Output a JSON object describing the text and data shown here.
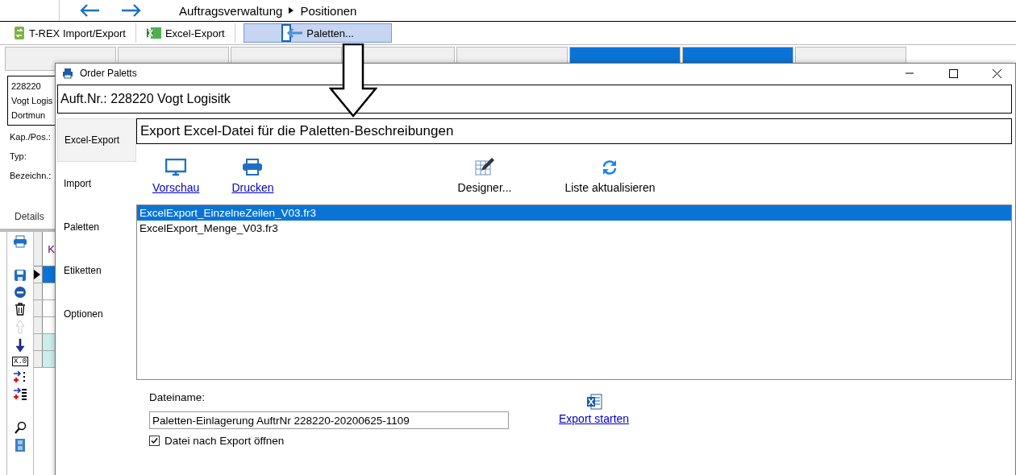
{
  "breadcrumb": [
    "Auftragsverwaltung",
    "Positionen"
  ],
  "toolbar": [
    {
      "kind": "sync",
      "label": "T-REX Import/Export",
      "selected": false
    },
    {
      "kind": "excel",
      "label": "Excel-Export",
      "selected": false
    },
    {
      "kind": "pallet",
      "label": "Paletten...",
      "selected": true
    }
  ],
  "view_tabs": [
    {
      "highlighted": false
    },
    {
      "highlighted": false
    },
    {
      "highlighted": false
    },
    {
      "highlighted": false
    },
    {
      "highlighted": false
    },
    {
      "highlighted": true
    },
    {
      "highlighted": true
    },
    {
      "highlighted": false
    }
  ],
  "order_box": [
    "228220",
    "Vogt Logis",
    "Dortmun"
  ],
  "fields": [
    "Kap./Pos.:",
    "Typ:",
    "Bezeichn.:"
  ],
  "details": "Details",
  "side_tools": [
    {
      "kind": "print"
    },
    {
      "kind": "save"
    },
    {
      "kind": "remove"
    },
    {
      "kind": "trash"
    },
    {
      "kind": "up",
      "disabled": true
    },
    {
      "kind": "down",
      "disabled": false
    },
    {
      "kind": "decimal",
      "label": "X.0"
    },
    {
      "kind": "insert"
    },
    {
      "kind": "insert-list"
    },
    {
      "kind": "search"
    },
    {
      "kind": "film"
    }
  ],
  "grid": {
    "column_1": "K",
    "rows": [
      {
        "selected": true,
        "tinted": false
      },
      {
        "selected": false,
        "tinted": false
      },
      {
        "selected": false,
        "tinted": false
      },
      {
        "selected": false,
        "tinted": false
      },
      {
        "selected": false,
        "tinted": true
      },
      {
        "selected": false,
        "tinted": true
      }
    ]
  },
  "dialog": {
    "title": "Order Paletts",
    "header": "Auft.Nr.: 228220 Vogt Logisitk",
    "nav": [
      {
        "label": "Excel-Export",
        "selected": true
      },
      {
        "label": "Import",
        "selected": false
      },
      {
        "label": "Paletten",
        "selected": false
      },
      {
        "label": "Etiketten",
        "selected": false
      },
      {
        "label": "Optionen",
        "selected": false
      }
    ],
    "section_title": "Export Excel-Datei für die Paletten-Beschreibungen",
    "actions": [
      {
        "kind": "link",
        "label": "Vorschau"
      },
      {
        "kind": "link",
        "label": "Drucken"
      },
      {
        "kind": "button",
        "label": "Designer..."
      },
      {
        "kind": "button",
        "label": "Liste aktualisieren"
      }
    ],
    "files": [
      {
        "name": "ExcelExport_EinzelneZeilen_V03.fr3",
        "selected": true
      },
      {
        "name": "ExcelExport_Menge_V03.fr3",
        "selected": false
      }
    ],
    "filename_label": "Dateiname:",
    "filename": "Paletten-Einlagerung AuftrNr 228220-20200625-1109",
    "open_after": {
      "label": "Datei nach Export öffnen",
      "checked": true
    },
    "export_button": "Export starten"
  }
}
